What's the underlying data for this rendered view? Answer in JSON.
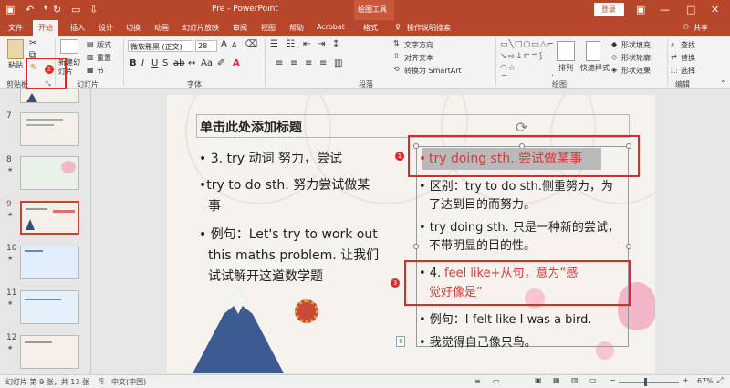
{
  "titlebar": {
    "title": "Pre  -  PowerPoint",
    "context_tab": "绘图工具",
    "login": "登录"
  },
  "menu": {
    "items": [
      "文件",
      "开始",
      "插入",
      "设计",
      "切换",
      "动画",
      "幻灯片放映",
      "审阅",
      "视图",
      "帮助",
      "Acrobat",
      "格式"
    ],
    "active": "开始",
    "tell_me": "操作说明搜索",
    "share": "共享"
  },
  "ribbon": {
    "clipboard": {
      "paste": "粘贴",
      "group": "剪贴板"
    },
    "slides": {
      "new_slide": "新建幻灯片",
      "layout": "版式",
      "reset": "重置",
      "section": "节",
      "group": "幻灯片"
    },
    "font": {
      "name": "微软雅黑 (正文)",
      "size": "28",
      "group": "字体"
    },
    "paragraph": {
      "text_direction": "文字方向",
      "align_text": "对齐文本",
      "smartart": "转换为 SmartArt",
      "group": "段落"
    },
    "drawing": {
      "arrange": "排列",
      "quick_styles": "快速样式",
      "fill": "形状填充",
      "outline": "形状轮廓",
      "effects": "形状效果",
      "group": "绘图"
    },
    "editing": {
      "find": "查找",
      "replace": "替换",
      "select": "选择",
      "group": "编辑"
    }
  },
  "thumbnails": [
    {
      "num": "7"
    },
    {
      "num": "8"
    },
    {
      "num": "9"
    },
    {
      "num": "10"
    },
    {
      "num": "11"
    },
    {
      "num": "12"
    }
  ],
  "slide": {
    "title": "单击此处添加标题",
    "left": {
      "b1": "• 3. try 动词  努力，尝试",
      "b2a": "•try to do sth. 努力尝试做某",
      "b2b": "事",
      "b3a": "•  例句：Let's try to work out",
      "b3b": "this maths problem. 让我们",
      "b3c": "试试解开这道数学题"
    },
    "right": {
      "r1": "try doing sth. 尝试做某事",
      "r2a": "• 区别：try to do sth.侧重努力，为",
      "r2b": "了达到目的而努力。",
      "r3a": "• try doing sth. 只是一种新的尝试，",
      "r3b": "不带明显的目的性。",
      "r4a_prefix": "• 4.",
      "r4a": "feel like+从句，意为“感",
      "r4b": "觉好像是”",
      "r5": "• 例句：I felt like I was a bird.",
      "r6": "• 我觉得自己像只鸟。"
    }
  },
  "badges": {
    "b1": "1",
    "b2": "2",
    "b3": "3"
  },
  "status": {
    "slide_info": "幻灯片 第 9 张，共 13 张",
    "language": "中文(中国)",
    "zoom": "67%"
  },
  "colors": {
    "brand": "#b7472a",
    "annotation": "#e02828",
    "highlight_text": "#d63a3a"
  }
}
